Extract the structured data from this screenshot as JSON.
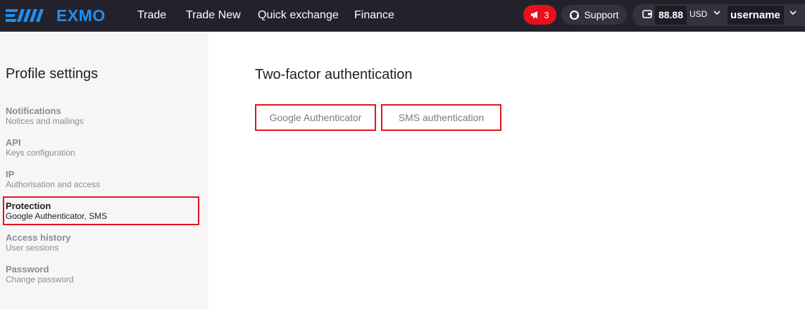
{
  "header": {
    "brand": "EXMO",
    "nav": [
      {
        "label": "Trade"
      },
      {
        "label": "Trade New"
      },
      {
        "label": "Quick exchange"
      },
      {
        "label": "Finance"
      }
    ],
    "notifications_count": "3",
    "support_label": "Support",
    "balance": "88.88",
    "currency": "USD",
    "username": "username",
    "icons": [
      "exmo-logo-icon",
      "megaphone-icon",
      "headset-icon",
      "wallet-icon",
      "chevron-down-icon"
    ],
    "colors": {
      "bar": "#23222c",
      "brand": "#1f8ff2",
      "notification": "#e8101b"
    }
  },
  "sidebar": {
    "title": "Profile settings",
    "items": [
      {
        "title": "Notifications",
        "subtitle": "Notices and mailings",
        "active": false
      },
      {
        "title": "API",
        "subtitle": "Keys configuration",
        "active": false
      },
      {
        "title": "IP",
        "subtitle": "Authorisation and access",
        "active": false
      },
      {
        "title": "Protection",
        "subtitle": "Google Authenticator, SMS",
        "active": true
      },
      {
        "title": "Access history",
        "subtitle": "User sessions",
        "active": false
      },
      {
        "title": "Password",
        "subtitle": "Change password",
        "active": false
      }
    ]
  },
  "main": {
    "title": "Two-factor authentication",
    "options": [
      {
        "label": "Google Authenticator"
      },
      {
        "label": "SMS authentication"
      }
    ]
  },
  "highlight_color": "#e3141b"
}
